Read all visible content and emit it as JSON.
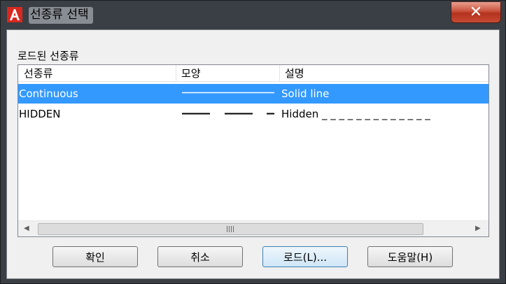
{
  "window": {
    "title": "선종류 선택",
    "close_label": "✕"
  },
  "group_label": "로드된 선종류",
  "columns": [
    "선종류",
    "모양",
    "설명"
  ],
  "rows": [
    {
      "name": "Continuous",
      "pattern": "solid",
      "description": "Solid line",
      "selected": true
    },
    {
      "name": "HIDDEN",
      "pattern": "dashed",
      "description": "Hidden _ _ _ _ _ _ _ _ _ _ _ _ _",
      "selected": false
    }
  ],
  "scrollbar": {
    "left_arrow": "◀",
    "right_arrow": "▶"
  },
  "buttons": {
    "ok": "확인",
    "cancel": "취소",
    "load": "로드(L)...",
    "help": "도움말(H)"
  },
  "colors": {
    "selection": "#3399ff",
    "frame": "#3a3f45",
    "close_button": "#c9523c"
  }
}
